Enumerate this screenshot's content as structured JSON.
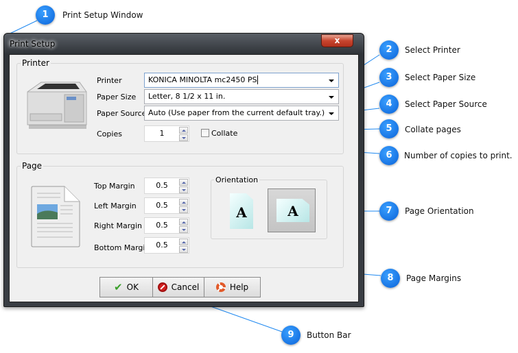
{
  "window": {
    "title": "Print Setup",
    "close_label": "x"
  },
  "printer_group": {
    "label": "Printer",
    "printer_label": "Printer",
    "printer_value": "KONICA MINOLTA mc2450 PS",
    "paper_size_label": "Paper Size",
    "paper_size_value": "Letter, 8 1/2 x 11 in.",
    "paper_source_label": "Paper Source",
    "paper_source_value": "Auto (Use paper from the current default tray.)",
    "copies_label": "Copies",
    "copies_value": "1",
    "collate_label": "Collate",
    "collate_checked": false
  },
  "page_group": {
    "label": "Page",
    "top_label": "Top Margin",
    "top_value": "0.5",
    "left_label": "Left Margin",
    "left_value": "0.5",
    "right_label": "Right Margin",
    "right_value": "0.5",
    "bottom_label": "Bottom Margin",
    "bottom_value": "0.5",
    "orientation_label": "Orientation",
    "orientation_selected": "landscape",
    "glyph": "A"
  },
  "buttons": {
    "ok": "OK",
    "cancel": "Cancel",
    "help": "Help"
  },
  "callouts": [
    {
      "n": "1",
      "text": "Print Setup Window"
    },
    {
      "n": "2",
      "text": "Select Printer"
    },
    {
      "n": "3",
      "text": "Select Paper Size"
    },
    {
      "n": "4",
      "text": "Select Paper Source"
    },
    {
      "n": "5",
      "text": "Collate pages"
    },
    {
      "n": "6",
      "text": "Number of copies to print."
    },
    {
      "n": "7",
      "text": "Page Orientation"
    },
    {
      "n": "8",
      "text": "Page Margins"
    },
    {
      "n": "9",
      "text": "Button Bar"
    }
  ],
  "colors": {
    "callout": "#0a74f0",
    "accent_line": "#1e88f0"
  }
}
